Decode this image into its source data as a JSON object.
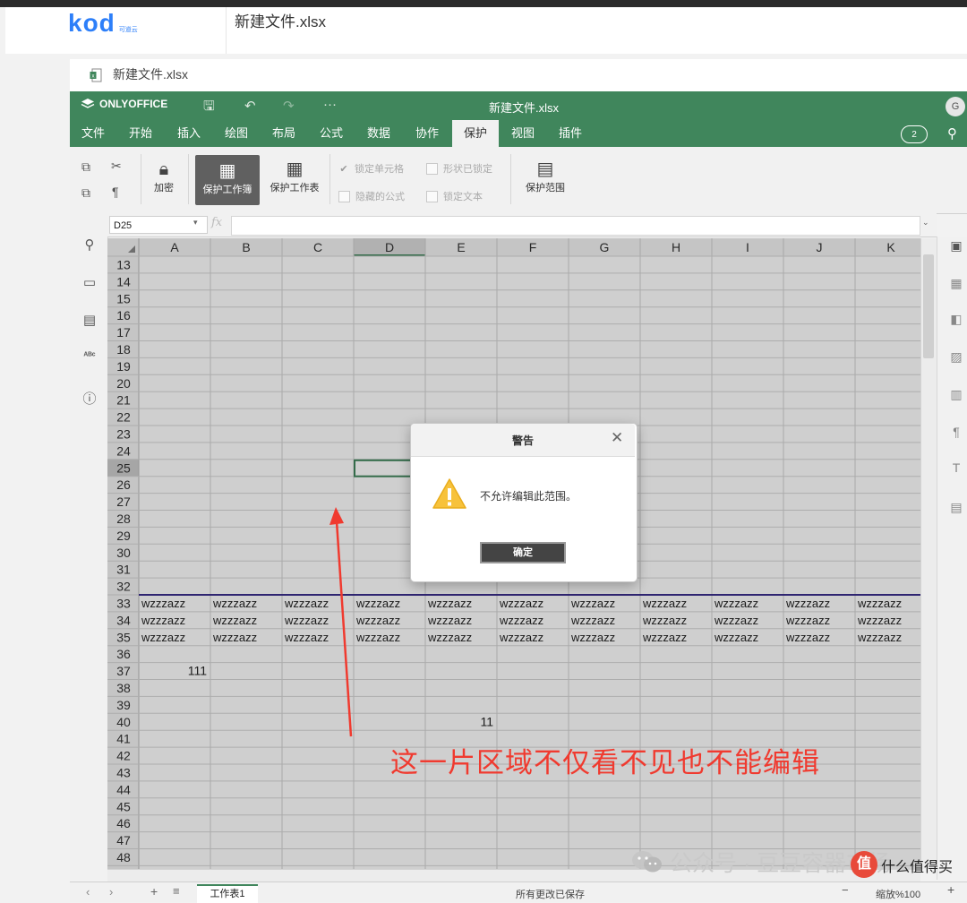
{
  "app": {
    "logo": "kod",
    "logo_sub": "可道云",
    "header_title": "新建文件.xlsx",
    "file_band_title": "新建文件.xlsx"
  },
  "onlyoffice": {
    "brand": "ONLYOFFICE",
    "doc_title": "新建文件.xlsx",
    "avatar": "G",
    "comments_count": "2",
    "more": "···",
    "tabs": [
      {
        "label": "文件"
      },
      {
        "label": "开始"
      },
      {
        "label": "插入"
      },
      {
        "label": "绘图"
      },
      {
        "label": "布局"
      },
      {
        "label": "公式"
      },
      {
        "label": "数据"
      },
      {
        "label": "协作"
      },
      {
        "label": "保护"
      },
      {
        "label": "视图"
      },
      {
        "label": "插件"
      }
    ],
    "active_tab": "保护"
  },
  "toolbar": {
    "encrypt": "加密",
    "protect_workbook": "保护工作簿",
    "protect_sheet": "保护工作表",
    "locked_cell": "锁定单元格",
    "shape_locked": "形状已锁定",
    "hidden_formula": "隐藏的公式",
    "lock_text": "锁定文本",
    "protect_range": "保护范围"
  },
  "formula_bar": {
    "name_box": "D25",
    "fx": "fx",
    "formula": ""
  },
  "grid": {
    "columns": [
      "A",
      "B",
      "C",
      "D",
      "E",
      "F",
      "G",
      "H",
      "I",
      "J",
      "K"
    ],
    "selected_column": "D",
    "first_row": 13,
    "last_row": 48,
    "selected_cell": "D25",
    "rows_33_35_text": "wzzzazz",
    "cell_A37": "111",
    "cell_E40": "11"
  },
  "dialog": {
    "title": "警告",
    "message": "不允许编辑此范围。",
    "ok": "确定"
  },
  "status": {
    "sheet_tab": "工作表1",
    "saved": "所有更改已保存",
    "zoom": "缩放%100"
  },
  "annotation": "这一片区域不仅看不见也不能编辑",
  "watermark": {
    "text": "公众号 · 豆豆容器市场",
    "badge": "值",
    "site": "什么值得买"
  },
  "colors": {
    "brand_green": "#40865c",
    "annotation_red": "#f03a2f",
    "kod_blue": "#2d7ff9",
    "border_line_purple": "#3a2e8c"
  }
}
